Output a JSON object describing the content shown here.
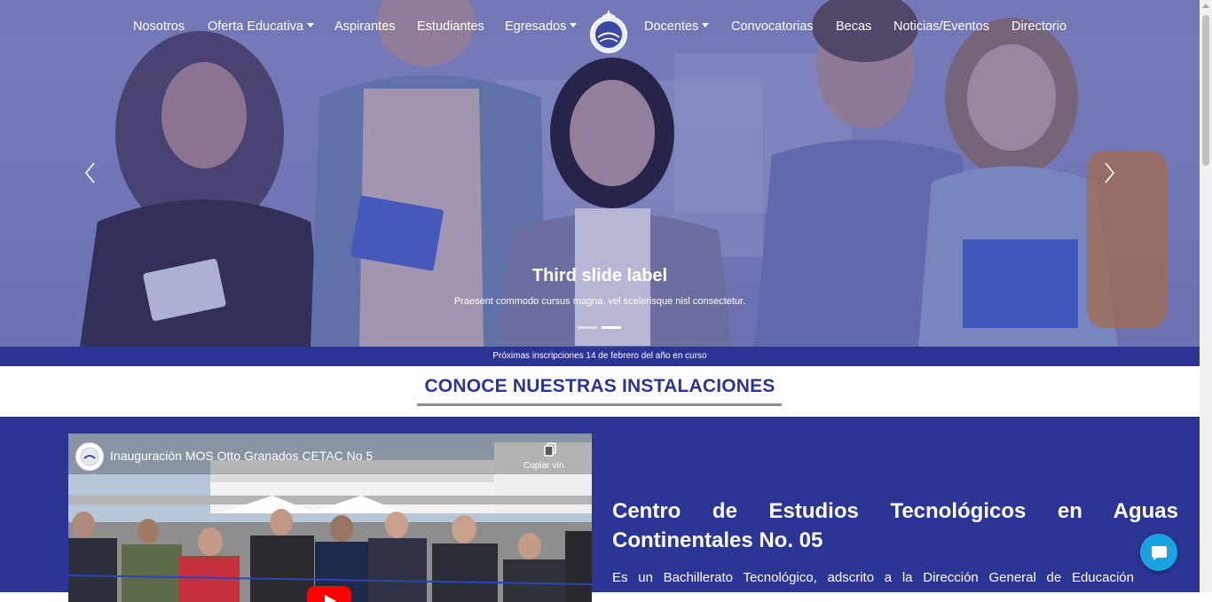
{
  "nav": {
    "items": [
      {
        "label": "Nosotros",
        "dropdown": false
      },
      {
        "label": "Oferta Educativa",
        "dropdown": true
      },
      {
        "label": "Aspirantes",
        "dropdown": false
      },
      {
        "label": "Estudiantes",
        "dropdown": false
      },
      {
        "label": "Egresados",
        "dropdown": true
      },
      {
        "label": "Docentes",
        "dropdown": true
      },
      {
        "label": "Convocatorias",
        "dropdown": false
      },
      {
        "label": "Becas",
        "dropdown": false
      },
      {
        "label": "Noticias/Eventos",
        "dropdown": false
      },
      {
        "label": "Directorio",
        "dropdown": false
      }
    ],
    "logo_icon": "institution-logo"
  },
  "carousel": {
    "caption_title": "Third slide label",
    "caption_text": "Praesent commodo cursus magna, vel scelerisque nisl consectetur.",
    "slide_count": 2,
    "active_slide": 2,
    "prev_icon": "chevron-left-icon",
    "next_icon": "chevron-right-icon"
  },
  "banner": {
    "text": "Próximas inscripciones 14 de febrero del año en curso"
  },
  "section": {
    "title": "CONOCE NUESTRAS INSTALACIONES"
  },
  "video": {
    "title": "Inauguración MOS Otto Granados CETAC No 5",
    "copy_label": "Copiar vín",
    "copy_icon": "copy-icon",
    "play_icon": "youtube-play-icon"
  },
  "info": {
    "title_line1": "Centro de Estudios Tecnológicos en Aguas",
    "title_line2": "Continentales No. 05",
    "text": "Es un Bachillerato Tecnológico, adscrito a la Dirección General de Educación"
  },
  "chat": {
    "icon": "chat-bubble-icon"
  },
  "colors": {
    "brand_blue": "#2b3593",
    "chat_blue": "#1aa3e0",
    "underline_gray": "#8b8b8b"
  }
}
